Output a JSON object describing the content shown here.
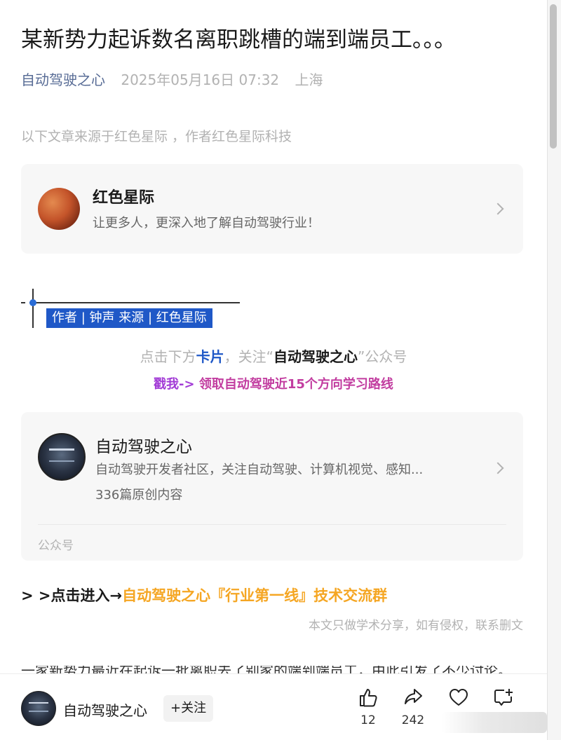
{
  "article": {
    "title": "某新势力起诉数名离职跳槽的端到端员工。。。",
    "account": "自动驾驶之心",
    "date": "2025年05月16日 07:32",
    "location": "上海",
    "source_note": "以下文章来源于红色星际 ，作者红色星际科技"
  },
  "source_card": {
    "name": "红色星际",
    "description": "让更多人，更深入地了解自动驾驶行业！",
    "avatar_icon": "mars-planet-avatar"
  },
  "author_badge": "作者 | 钟声 来源 |  红色星际",
  "follow_prompt": {
    "prefix": "点击下方",
    "card_word": "卡片",
    "middle": "，关注“",
    "account": "自动驾驶之心",
    "suffix": "”公众号"
  },
  "route_prompt": {
    "part1": "戳我-> ",
    "part2": "领取自动驾驶近15个方向学习路线"
  },
  "account_card": {
    "name": "自动驾驶之心",
    "description": "自动驾驶开发者社区，关注自动驾驶、计算机视觉、感知...",
    "count": "336篇原创内容",
    "kind": "公众号"
  },
  "group_link": {
    "prefix": "> >点击进入→",
    "highlight": "自动驾驶之心『行业第一线』技术交流群"
  },
  "disclaimer": "本文只做学术分享，如有侵权，联系删文",
  "partial_text": "一家新势力最近在起诉一批离职去了别家的端到端员工，由此引发了不少讨论。",
  "bottom_bar": {
    "account_name": "自动驾驶之心",
    "follow_label": "+关注",
    "like_count": "12",
    "share_count": "242"
  },
  "colors": {
    "link_blue": "#576b95",
    "badge_blue": "#1f58c7",
    "orange": "#f5a623",
    "purple": "#a23bd6"
  }
}
